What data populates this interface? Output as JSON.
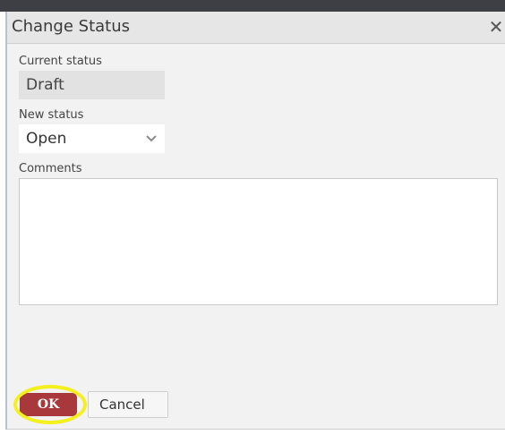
{
  "dialog": {
    "title": "Change Status",
    "close_icon": "close-icon",
    "current_status": {
      "label": "Current status",
      "value": "Draft"
    },
    "new_status": {
      "label": "New status",
      "selected": "Open",
      "icon": "chevron-down-icon"
    },
    "comments": {
      "label": "Comments",
      "value": ""
    },
    "buttons": {
      "ok": "OK",
      "cancel": "Cancel"
    }
  },
  "colors": {
    "ok_button": "#a8383c",
    "highlight": "#f4ef1e",
    "titlebar": "#e6e6e6",
    "top_strip": "#3d3f44"
  },
  "annotation": {
    "highlight_target": "ok-button"
  }
}
